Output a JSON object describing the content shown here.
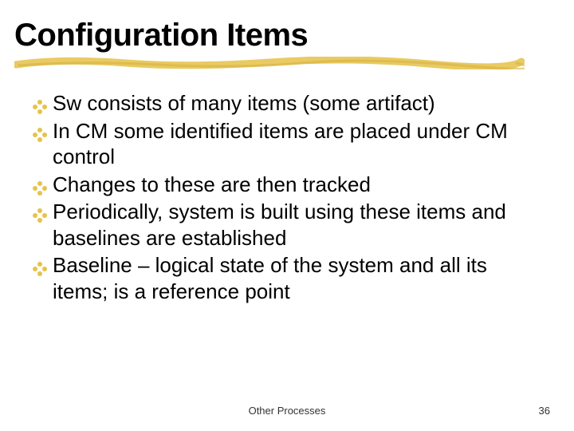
{
  "slide": {
    "title": "Configuration Items",
    "bullets": [
      "Sw consists of many items (some artifact)",
      "In CM some identified items are placed under CM control",
      "Changes to these are then tracked",
      "Periodically, system is built using these items and baselines are established",
      "Baseline – logical state of the system and all its items; is a reference point"
    ],
    "footer": "Other Processes",
    "page_number": "36"
  },
  "colors": {
    "accent": "#e6c34a"
  }
}
